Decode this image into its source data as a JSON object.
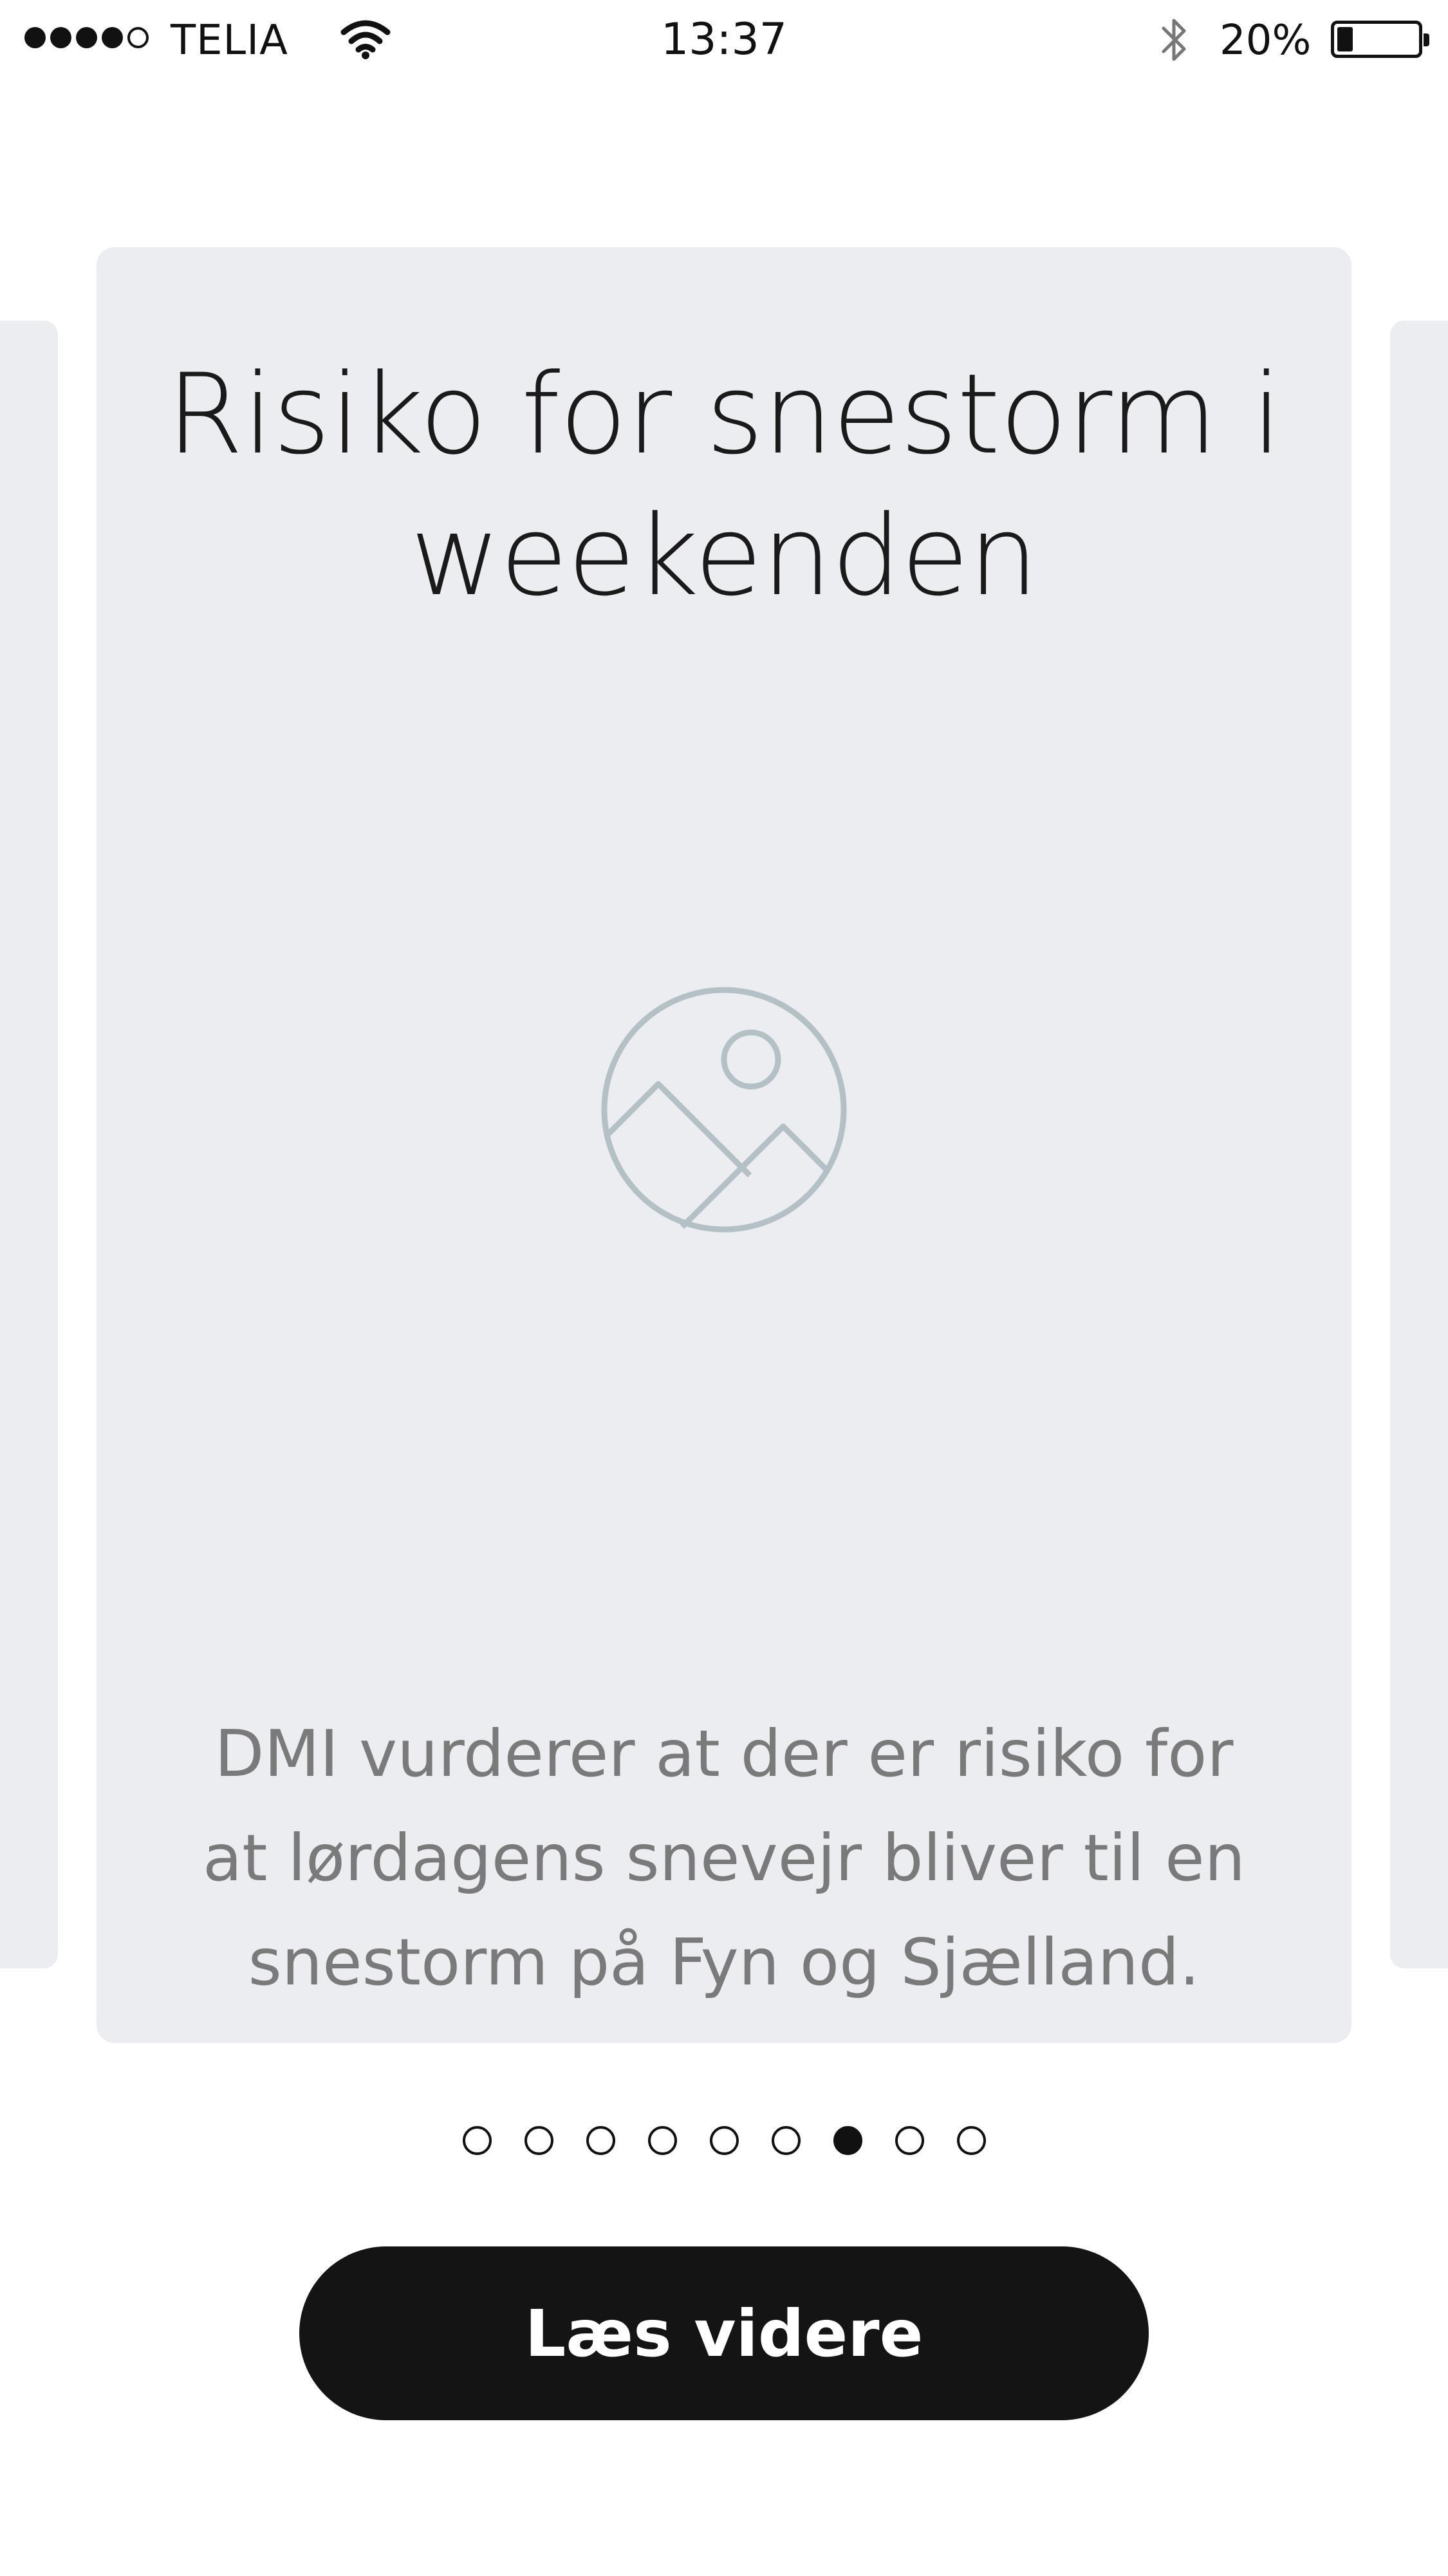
{
  "status_bar": {
    "signal_bars_filled": 4,
    "signal_bars_total": 5,
    "carrier": "TELIA",
    "time": "13:37",
    "battery_percent_label": "20%",
    "battery_level": 0.2,
    "icons": [
      "wifi-icon",
      "bluetooth-icon",
      "battery-icon"
    ]
  },
  "card": {
    "title": "Risiko for snestorm i weekenden",
    "image_icon": "image-placeholder-icon",
    "body": "DMI vurderer at der er risiko for at lørdagens snevejr bliver til en snestorm på Fyn og Sjælland."
  },
  "pagination": {
    "total": 9,
    "active_index": 6
  },
  "button": {
    "label": "Læs videre"
  },
  "colors": {
    "card_background": "#ebedf0",
    "icon_stroke": "#b3c0c6",
    "button_background": "#141414",
    "body_text": "#7a7a7a"
  }
}
